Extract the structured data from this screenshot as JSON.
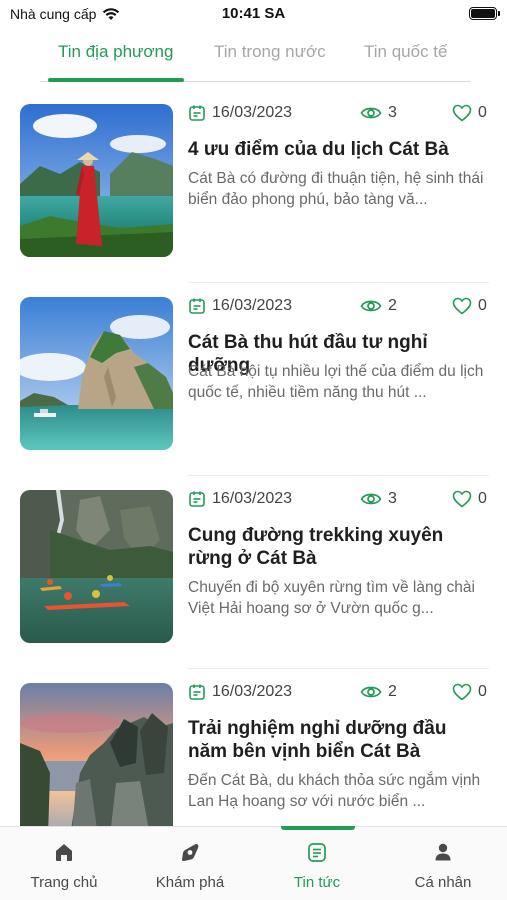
{
  "status_bar": {
    "carrier": "Nhà cung cấp",
    "time": "10:41 SA",
    "battery_level": 1.0
  },
  "tabs": [
    {
      "label": "Tin địa phương",
      "active": true
    },
    {
      "label": "Tin trong nước",
      "active": false
    },
    {
      "label": "Tin quốc tế",
      "active": false
    }
  ],
  "articles": [
    {
      "date": "16/03/2023",
      "views": "3",
      "likes": "0",
      "title": "4 ưu điểm của du lịch Cát Bà",
      "description": "Cát Bà có đường đi thuận tiện, hệ sinh thái biển đảo phong phú, bảo tàng vă...",
      "image": "woman-in-red-dress-overlooking-bay"
    },
    {
      "date": "16/03/2023",
      "views": "2",
      "likes": "0",
      "title": "Cát Bà thu hút đầu tư nghỉ dưỡng",
      "description": "Cát Bà hội tụ nhiều lợi thế của điểm du lịch quốc tế, nhiều tiềm năng thu hút ...",
      "image": "limestone-karst-island-in-sea"
    },
    {
      "date": "16/03/2023",
      "views": "3",
      "likes": "0",
      "title": "Cung đường trekking xuyên rừng ở Cát Bà",
      "description": "Chuyến đi bộ xuyên rừng tìm về làng chài Việt Hải hoang sơ ở Vườn quốc g...",
      "image": "kayakers-among-cliffs"
    },
    {
      "date": "16/03/2023",
      "views": "2",
      "likes": "0",
      "title": "Trải nghiệm nghỉ dưỡng đầu năm bên vịnh biển Cát Bà",
      "description": "Đến Cát Bà, du khách thỏa sức ngắm vịnh Lan Hạ hoang sơ với nước biển ...",
      "image": "sunset-over-bay-with-rocks"
    }
  ],
  "bottom_nav": [
    {
      "label": "Trang chủ",
      "icon": "home-icon",
      "active": false
    },
    {
      "label": "Khám phá",
      "icon": "explore-icon",
      "active": false
    },
    {
      "label": "Tin tức",
      "icon": "news-icon",
      "active": true
    },
    {
      "label": "Cá nhân",
      "icon": "person-icon",
      "active": false
    }
  ],
  "colors": {
    "accent": "#239b56",
    "inactive_tab": "#a6a6a6",
    "description_text": "#6a6a6a"
  }
}
